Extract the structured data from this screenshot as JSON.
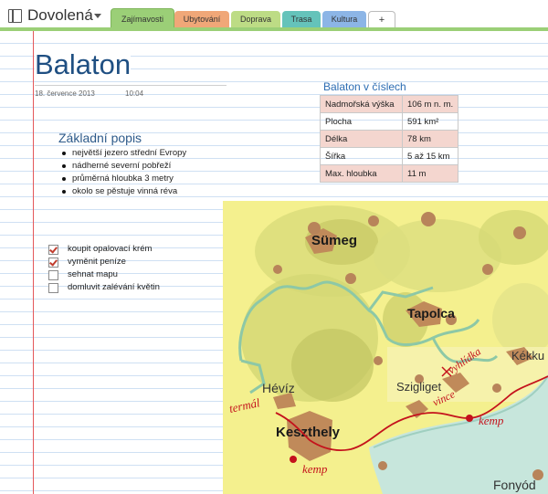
{
  "notebook": {
    "title": "Dovolená"
  },
  "tabs": [
    {
      "label": "Zajímavosti",
      "color": "#9bcf77",
      "active": true
    },
    {
      "label": "Ubytování",
      "color": "#f0a778"
    },
    {
      "label": "Doprava",
      "color": "#bddc85"
    },
    {
      "label": "Trasa",
      "color": "#65c3ba"
    },
    {
      "label": "Kultura",
      "color": "#8cb5e6"
    },
    {
      "label": "+"
    }
  ],
  "page": {
    "title": "Balaton",
    "date": "18. července 2013",
    "time": "10:04"
  },
  "description": {
    "heading": "Základní popis",
    "items": [
      "největší jezero střední Evropy",
      "nádherné severní pobřeží",
      "průměrná hloubka 3 metry",
      "okolo se pěstuje vinná réva"
    ]
  },
  "todo": [
    {
      "label": "koupit opalovací krém",
      "checked": true
    },
    {
      "label": "vyměnit peníze",
      "checked": true
    },
    {
      "label": "sehnat mapu",
      "checked": false
    },
    {
      "label": "domluvit zalévání květin",
      "checked": false
    }
  ],
  "facts": {
    "heading": "Balaton v číslech",
    "rows": [
      {
        "label": "Nadmořská výška",
        "value": "106 m n. m."
      },
      {
        "label": "Plocha",
        "value": "591 km²"
      },
      {
        "label": "Délka",
        "value": "78 km"
      },
      {
        "label": "Šířka",
        "value": "5 až 15 km"
      },
      {
        "label": "Max. hloubka",
        "value": "11 m"
      }
    ]
  },
  "map": {
    "towns": [
      "Sümeg",
      "Tapolca",
      "Hévíz",
      "Keszthely",
      "Szigliget",
      "Kékku",
      "Fonyód"
    ],
    "annotations": [
      "termál",
      "vyhlídka",
      "vince",
      "kemp",
      "kemp"
    ]
  }
}
